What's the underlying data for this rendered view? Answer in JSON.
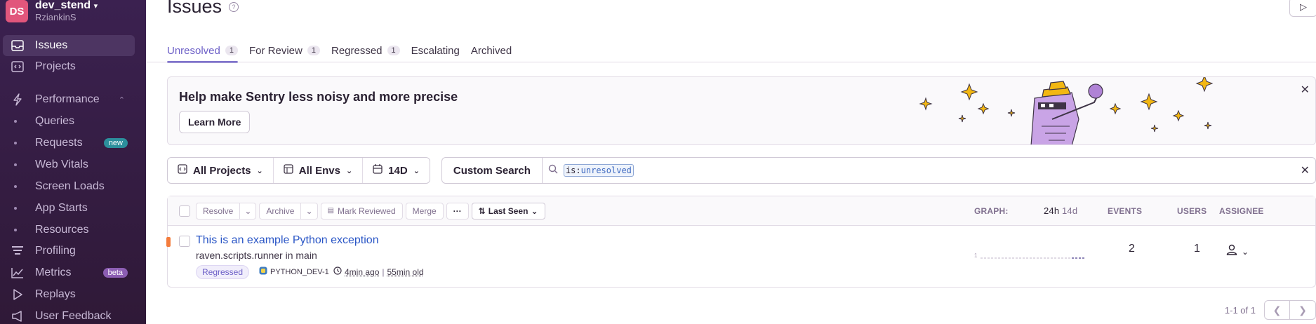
{
  "org": {
    "initials": "DS",
    "name": "dev_stend",
    "user": "RziankinS"
  },
  "sidebar": {
    "items": [
      {
        "label": "Issues"
      },
      {
        "label": "Projects"
      },
      {
        "label": "Performance"
      },
      {
        "label": "Queries"
      },
      {
        "label": "Requests",
        "badge": "new"
      },
      {
        "label": "Web Vitals"
      },
      {
        "label": "Screen Loads"
      },
      {
        "label": "App Starts"
      },
      {
        "label": "Resources"
      },
      {
        "label": "Profiling"
      },
      {
        "label": "Metrics",
        "badge": "beta"
      },
      {
        "label": "Replays"
      },
      {
        "label": "User Feedback"
      }
    ]
  },
  "header": {
    "title": "Issues"
  },
  "tabs": [
    {
      "label": "Unresolved",
      "count": "1"
    },
    {
      "label": "For Review",
      "count": "1"
    },
    {
      "label": "Regressed",
      "count": "1"
    },
    {
      "label": "Escalating"
    },
    {
      "label": "Archived"
    }
  ],
  "banner": {
    "title": "Help make Sentry less noisy and more precise",
    "button": "Learn More"
  },
  "filters": {
    "projects": "All Projects",
    "envs": "All Envs",
    "period": "14D",
    "custom_search": "Custom Search",
    "query_key": "is:",
    "query_value": "unresolved"
  },
  "table": {
    "actions": {
      "resolve": "Resolve",
      "archive": "Archive",
      "mark_reviewed": "Mark Reviewed",
      "merge": "Merge",
      "more": "···",
      "sort": "Last Seen"
    },
    "headers": {
      "graph": "GRAPH:",
      "h24": "24h",
      "d14": "14d",
      "events": "EVENTS",
      "users": "USERS",
      "assignee": "ASSIGNEE"
    },
    "rows": [
      {
        "title": "This is an example Python exception",
        "culprit": "raven.scripts.runner in main",
        "status": "Regressed",
        "short_id": "PYTHON_DEV-1",
        "last_seen": "4min ago",
        "age": "55min old",
        "graph_max": "1",
        "events": "2",
        "users": "1"
      }
    ]
  },
  "pagination": {
    "info": "1-1 of 1"
  },
  "colors": {
    "accent": "#6c5fc7",
    "sidebar": "#3b2150",
    "link": "#2a56c6",
    "level": "#f47c3c"
  }
}
